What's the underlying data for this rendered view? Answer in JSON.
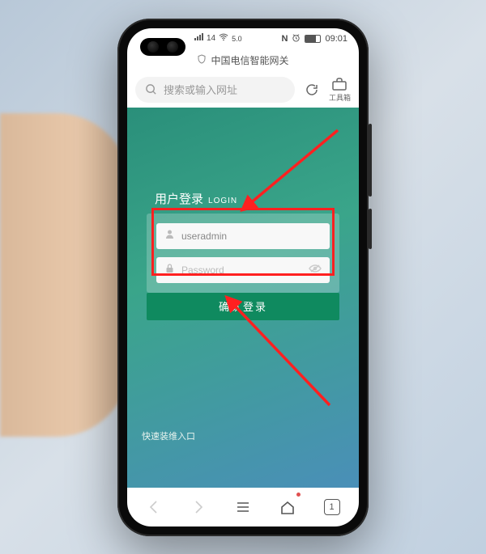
{
  "status": {
    "network": "14",
    "carrier_rate": "5.0",
    "nfc": "N",
    "time": "09:01"
  },
  "titlebar": {
    "page_title": "中国电信智能网关"
  },
  "urlbar": {
    "search_placeholder": "搜索或输入网址",
    "toolbox_label": "工具箱"
  },
  "login": {
    "title_cn": "用户登录",
    "title_en": "LOGIN",
    "username_value": "useradmin",
    "password_placeholder": "Password",
    "submit_label": "确认登录"
  },
  "footer": {
    "fast_install": "快速装维入口"
  },
  "bottomnav": {
    "tab_count": "1"
  }
}
